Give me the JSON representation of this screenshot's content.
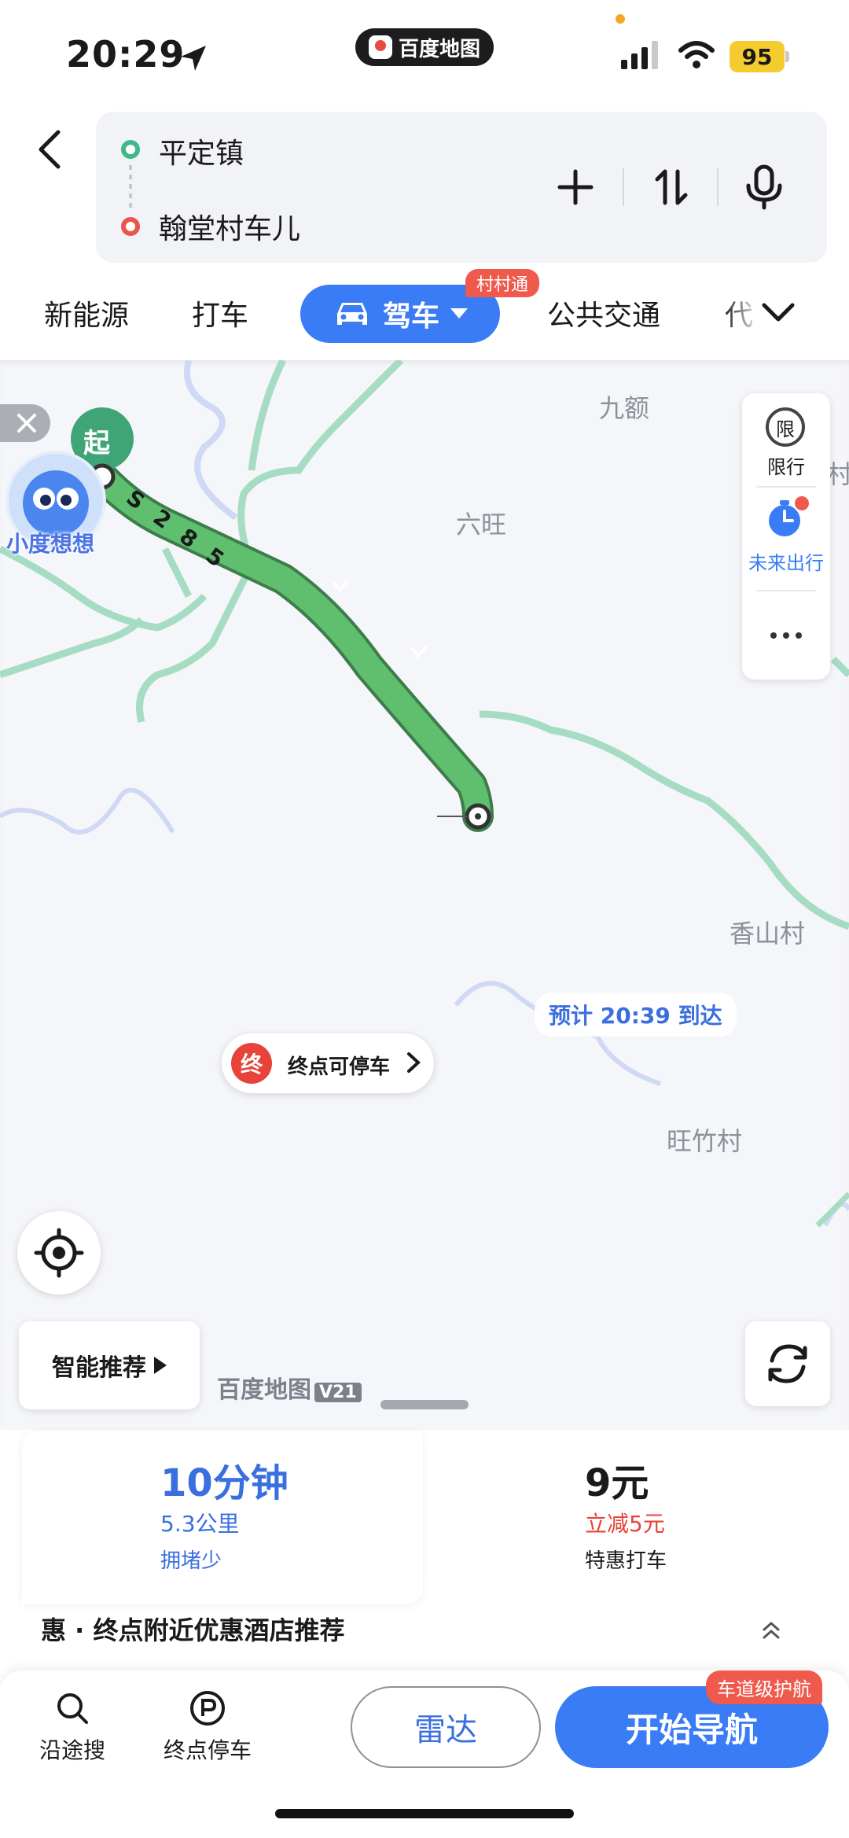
{
  "status_bar": {
    "time": "20:29",
    "app": "百度地图",
    "battery": "95"
  },
  "route": {
    "origin": "平定镇",
    "destination": "翰堂村车儿"
  },
  "tabs": {
    "items": [
      "新能源",
      "打车",
      "驾车",
      "公共交通",
      "代"
    ],
    "active_badge": "村村通"
  },
  "map": {
    "places": [
      "九额",
      "六旺",
      "香山村",
      "旺竹村",
      "村"
    ],
    "assistant_label": "小度想想",
    "side_panel": {
      "restrict_icon": "限",
      "restrict_label": "限行",
      "future_label": "未来出行"
    },
    "start_marker": "起",
    "road_label": "S285",
    "eta": "预计 20:39 到达",
    "end_marker": "终",
    "parking_label": "终点可停车",
    "smart_label": "智能推荐",
    "watermark": "百度地图",
    "watermark_version": "V21",
    "icons": [
      "close-icon",
      "locate-icon",
      "refresh-icon",
      "more-icon",
      "clock-icon"
    ]
  },
  "card": {
    "duration": "10分钟",
    "distance": "5.3公里",
    "traffic": "拥堵少",
    "price": "9元",
    "discount": "立减5元",
    "taxi_label": "特惠打车",
    "promo": "惠 · 终点附近优惠酒店推荐"
  },
  "bottom": {
    "search_label": "沿途搜",
    "parking_label": "终点停车",
    "radar_label": "雷达",
    "nav_label": "开始导航",
    "nav_badge": "车道级护航"
  },
  "colors": {
    "accent": "#3a7bf6",
    "route": "#5fbf6e",
    "danger": "#e8433a"
  }
}
